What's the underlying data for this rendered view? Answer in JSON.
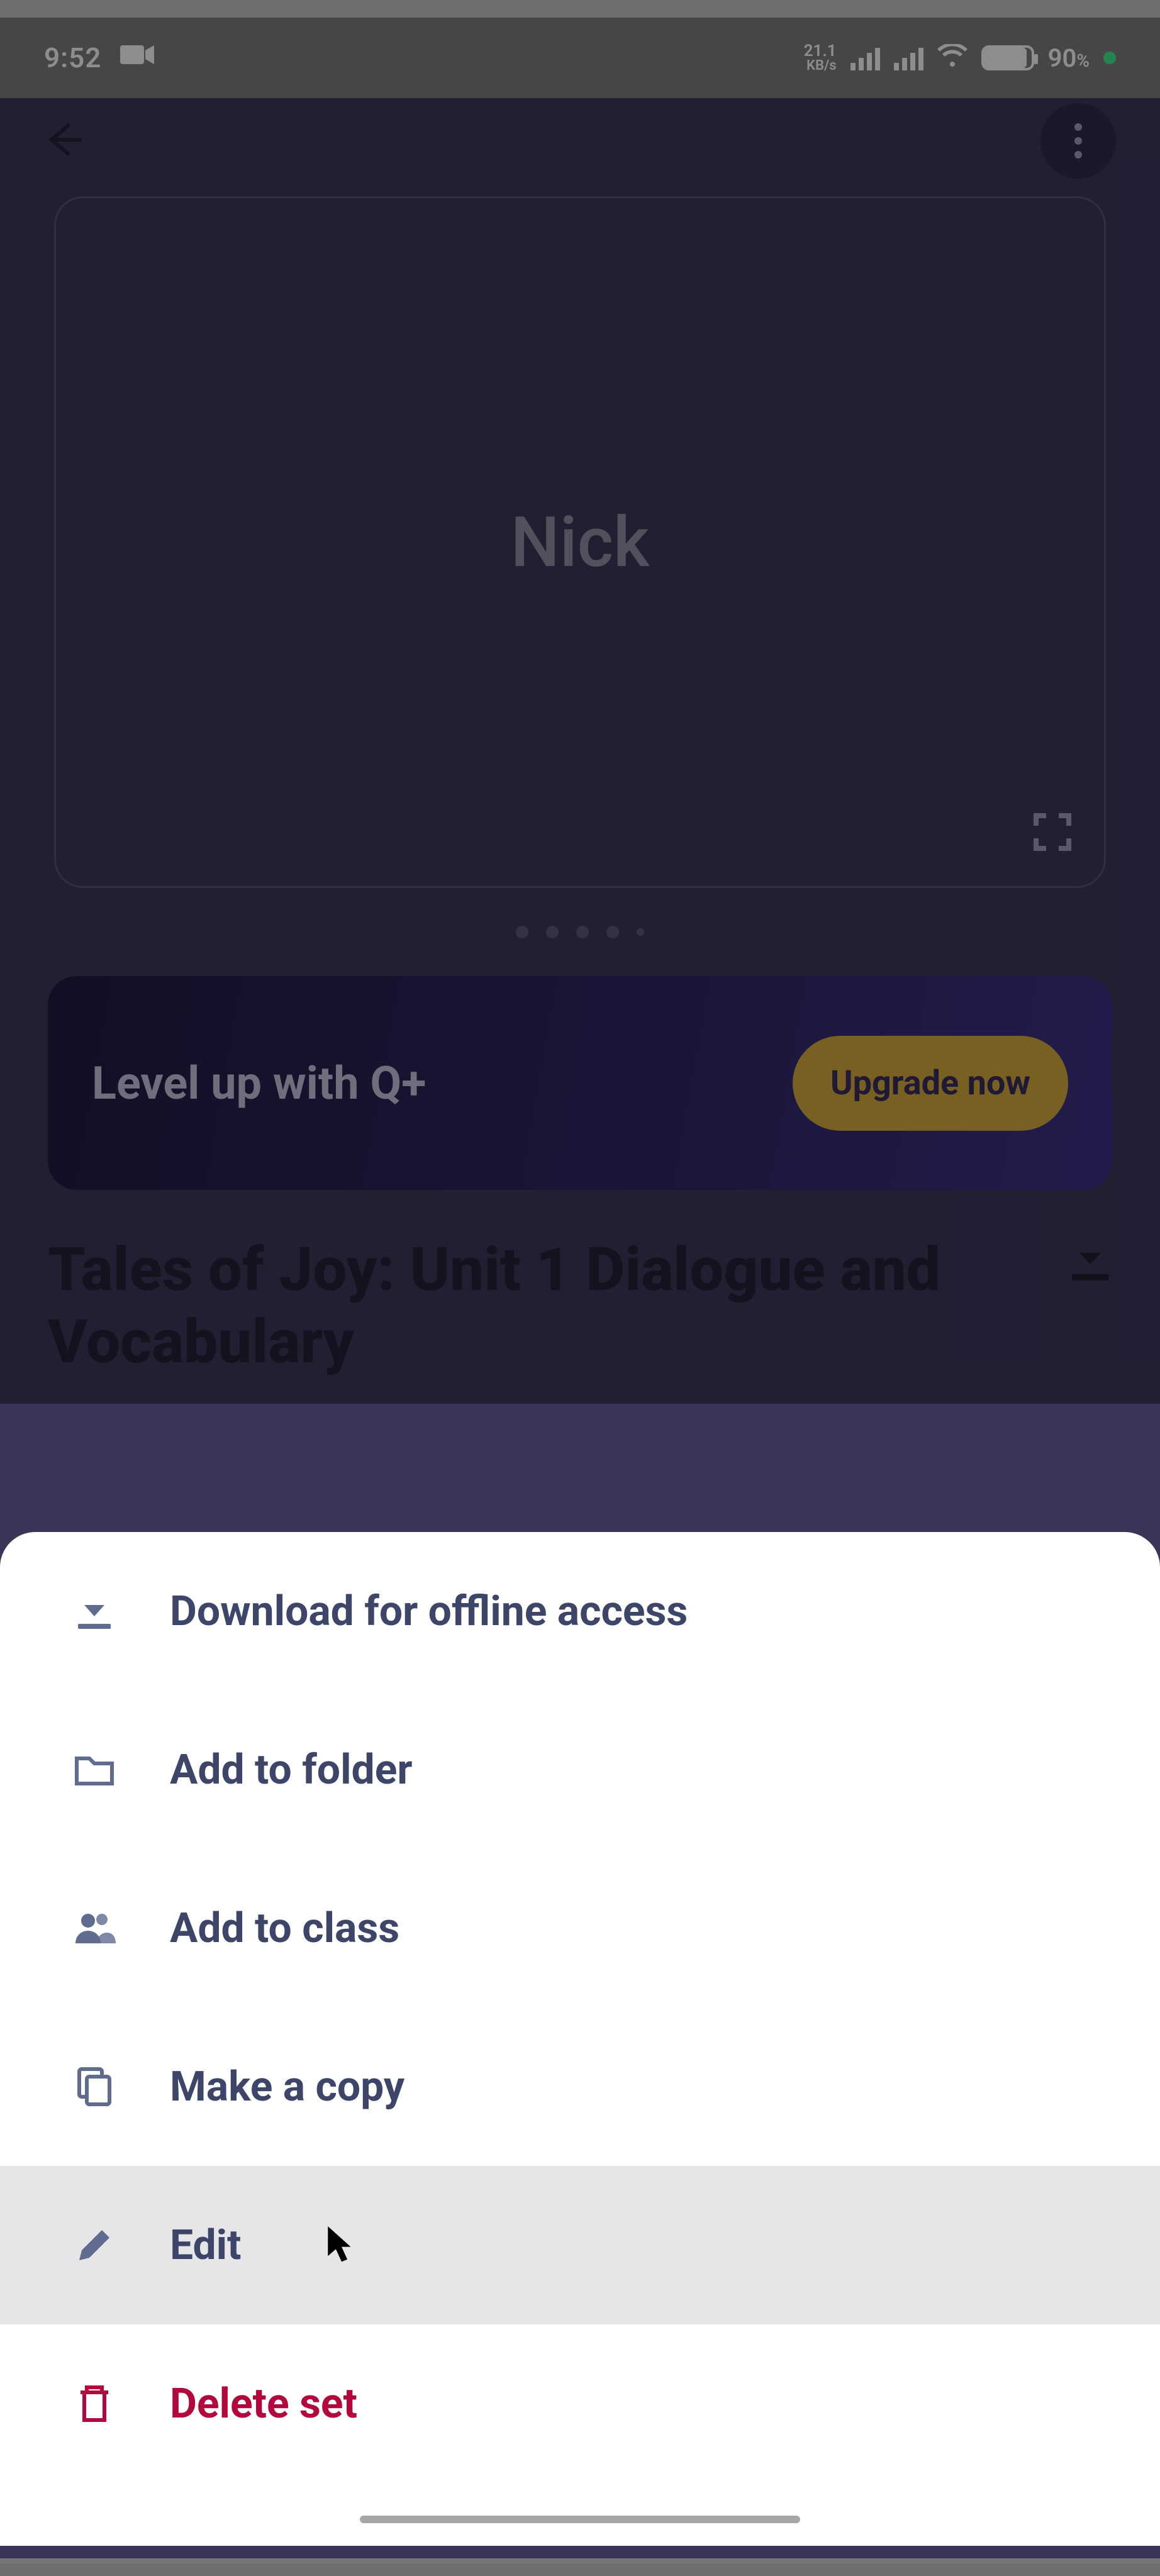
{
  "statusbar": {
    "time": "9:52",
    "data_rate_value": "21.1",
    "data_rate_unit": "KB/s",
    "battery_percent": "90",
    "battery_unit": "%"
  },
  "card": {
    "term": "Nick"
  },
  "promo": {
    "headline": "Level up with Q+",
    "cta": "Upgrade now"
  },
  "set": {
    "title": "Tales of Joy: Unit 1 Dialogue and Vocabulary"
  },
  "menu": {
    "download": "Download for offline access",
    "add_folder": "Add to folder",
    "add_class": "Add to class",
    "make_copy": "Make a copy",
    "edit": "Edit",
    "delete": "Delete set"
  }
}
